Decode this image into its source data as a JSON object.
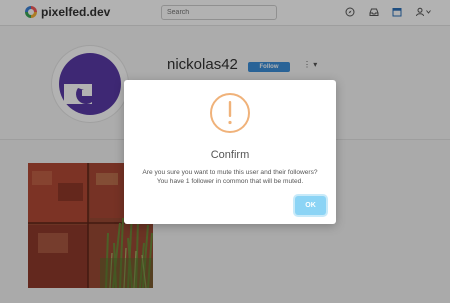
{
  "navbar": {
    "brand": "pixelfed.dev",
    "search_placeholder": "Search",
    "icons": [
      "compass-icon",
      "inbox-icon",
      "calendar-icon",
      "user-icon"
    ]
  },
  "profile": {
    "username": "nickolas42",
    "follow_label": "Follow",
    "more_label": "⋮ ▾"
  },
  "modal": {
    "title": "Confirm",
    "message_line1": "Are you sure you want to mute this user and their followers?",
    "message_line2": "You have 1 follower in common that will be muted.",
    "ok_label": "OK"
  },
  "colors": {
    "accent": "#3b8fd9",
    "warning": "#f0b27a",
    "ok_button": "#8cd4f5",
    "avatar": "#5a3aa6"
  }
}
